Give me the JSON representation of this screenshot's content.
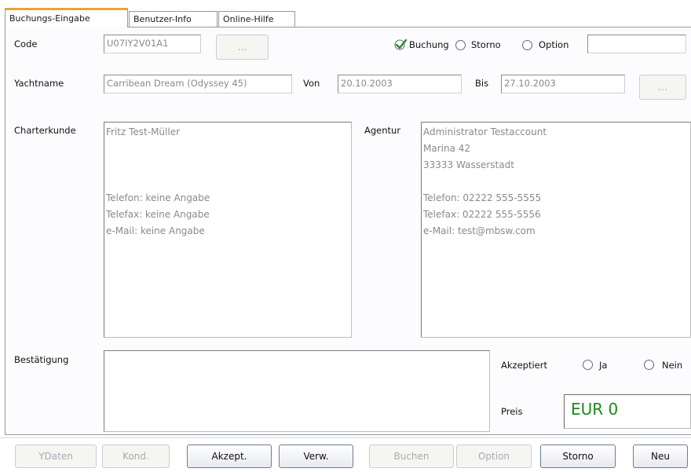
{
  "tabs": [
    {
      "label": "Buchungs-Eingabe"
    },
    {
      "label": "Benutzer-Info"
    },
    {
      "label": "Online-Hilfe"
    }
  ],
  "code": {
    "label": "Code",
    "value": "U07IY2V01A1",
    "browse_label": "..."
  },
  "booking_type": {
    "options": [
      {
        "label": "Buchung",
        "selected": true
      },
      {
        "label": "Storno",
        "selected": false
      },
      {
        "label": "Option",
        "selected": false
      }
    ],
    "option_value": ""
  },
  "yacht": {
    "label": "Yachtname",
    "value": "Carribean Dream (Odyssey 45)",
    "from_label": "Von",
    "from_value": "20.10.2003",
    "to_label": "Bis",
    "to_value": "27.10.2003",
    "browse_label": "..."
  },
  "customer": {
    "label": "Charterkunde",
    "text": "Fritz Test-Müller\n\n\n\nTelefon: keine Angabe\nTelefax: keine Angabe\ne-Mail: keine Angabe"
  },
  "agency": {
    "label": "Agentur",
    "text": "Administrator Testaccount\nMarina 42\n33333 Wasserstadt\n\nTelefon: 02222 555-5555\nTelefax: 02222 555-5556\ne-Mail: test@mbsw.com"
  },
  "confirmation": {
    "label": "Bestätigung",
    "text": ""
  },
  "accepted": {
    "label": "Akzeptiert",
    "options": [
      {
        "label": "Ja",
        "selected": false
      },
      {
        "label": "Nein",
        "selected": false
      }
    ]
  },
  "price": {
    "label": "Preis",
    "value": "EUR 0",
    "color": "#1a8a1a"
  },
  "buttons": [
    {
      "label": "YDaten",
      "enabled": false
    },
    {
      "label": "Kond.",
      "enabled": false
    },
    {
      "label": "Akzept.",
      "enabled": true
    },
    {
      "label": "Verw.",
      "enabled": true
    },
    {
      "label": "Buchen",
      "enabled": false
    },
    {
      "label": "Option",
      "enabled": false
    },
    {
      "label": "Storno",
      "enabled": true
    },
    {
      "label": "Neu",
      "enabled": true
    }
  ],
  "colors": {
    "accent_tab": "#f0a031",
    "check": "#2d8a2d"
  }
}
